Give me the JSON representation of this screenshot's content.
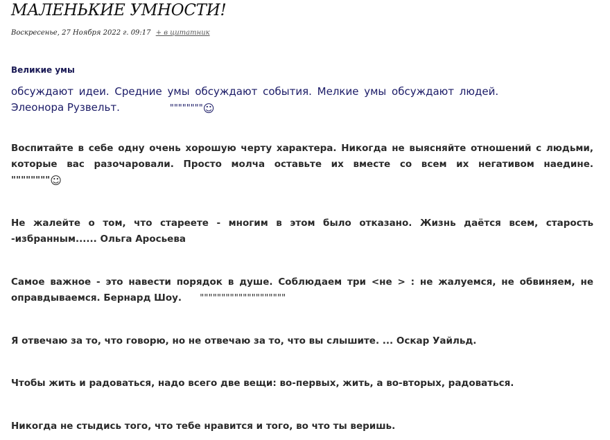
{
  "post": {
    "title": "МАЛЕНЬКИЕ УМНОСТИ!",
    "date": "Воскресенье, 27 Ноября 2022 г. 09:17",
    "quote_link": "+ в цитатник",
    "subhead": "Великие умы"
  },
  "quotes": {
    "q1": {
      "line1": "обсуждают идеи. Средние умы обсуждают события.   Мелкие умы обсуждают людей.",
      "line2_text": "Элеонора Рузвельт.",
      "line2_marks": "\"\"\"\"\"\"\"\"",
      "smile": "☺"
    },
    "q2": {
      "line1": "Воспитайте в себе одну очень хорошую черту характера. Никогда не выясняйте отношений с людьми,",
      "line2": "которые вас разочаровали.  Просто молча оставьте их вместе со всем их негативом наедине.",
      "line3_marks": "\"\"\"\"\"\"\"\"",
      "smile": "☺"
    },
    "q3": {
      "line1": "Не жалейте о том, что стареете - многим в этом  было отказано. Жизнь даётся всем, старость",
      "line2": "-избранным...... Ольга Аросьева"
    },
    "q4": {
      "line1": "Самое важное - это навести порядок в душе.  Соблюдаем три <не > :  не жалуемся,  не обвиняем, не",
      "line2_text": "оправдываемся.     Бернард Шоу.",
      "line2_marks": "\"\"\"\"\"\"\"\"\"\"\"\"\"\"\"\"\"\"\"\""
    },
    "q5": {
      "text": "Я отвечаю за то, что говорю, но не отвечаю за то, что вы слышите. ... Оскар Уайльд."
    },
    "q6": {
      "text": "Чтобы жить и радоваться, надо всего две вещи: во-первых, жить, а во-вторых, радоваться."
    },
    "q7": {
      "text": "Никогда не стыдись того, что тебе нравится и того, во что ты веришь."
    }
  }
}
